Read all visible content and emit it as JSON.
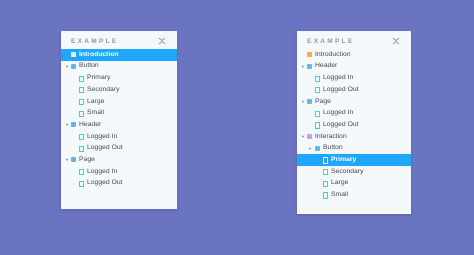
{
  "left_panel": {
    "title": "EXAMPLE",
    "rows": [
      {
        "label": "Introduction",
        "level": 0,
        "icon": "doc-icon",
        "arrow": "",
        "active": true
      },
      {
        "label": "Button",
        "level": 0,
        "icon": "component-icon",
        "arrow": "down",
        "active": false
      },
      {
        "label": "Primary",
        "level": 1,
        "icon": "story-icon",
        "arrow": "",
        "active": false
      },
      {
        "label": "Secondary",
        "level": 1,
        "icon": "story-icon",
        "arrow": "",
        "active": false
      },
      {
        "label": "Large",
        "level": 1,
        "icon": "story-icon",
        "arrow": "",
        "active": false
      },
      {
        "label": "Small",
        "level": 1,
        "icon": "story-icon",
        "arrow": "",
        "active": false
      },
      {
        "label": "Header",
        "level": 0,
        "icon": "component-icon",
        "arrow": "down",
        "active": false
      },
      {
        "label": "Logged In",
        "level": 1,
        "icon": "story-icon",
        "arrow": "",
        "active": false
      },
      {
        "label": "Logged Out",
        "level": 1,
        "icon": "story-icon",
        "arrow": "",
        "active": false
      },
      {
        "label": "Page",
        "level": 0,
        "icon": "component-icon",
        "arrow": "down",
        "active": false
      },
      {
        "label": "Logged In",
        "level": 1,
        "icon": "story-icon",
        "arrow": "",
        "active": false
      },
      {
        "label": "Logged Out",
        "level": 1,
        "icon": "story-icon",
        "arrow": "",
        "active": false
      }
    ]
  },
  "right_panel": {
    "title": "EXAMPLE",
    "rows": [
      {
        "label": "Introduction",
        "level": 0,
        "icon": "doc-icon",
        "arrow": "",
        "active": false
      },
      {
        "label": "Header",
        "level": 0,
        "icon": "component-icon",
        "arrow": "down",
        "active": false
      },
      {
        "label": "Logged In",
        "level": 1,
        "icon": "story-icon",
        "arrow": "",
        "active": false
      },
      {
        "label": "Logged Out",
        "level": 1,
        "icon": "story-icon",
        "arrow": "",
        "active": false
      },
      {
        "label": "Page",
        "level": 0,
        "icon": "component-icon",
        "arrow": "down",
        "active": false
      },
      {
        "label": "Logged In",
        "level": 1,
        "icon": "story-icon",
        "arrow": "",
        "active": false
      },
      {
        "label": "Logged Out",
        "level": 1,
        "icon": "story-icon",
        "arrow": "",
        "active": false
      },
      {
        "label": "Interaction",
        "level": 0,
        "icon": "folder-icon",
        "arrow": "down",
        "active": false
      },
      {
        "label": "Button",
        "level": 1,
        "icon": "component-icon",
        "arrow": "down",
        "active": false
      },
      {
        "label": "Primary",
        "level": 2,
        "icon": "story-icon",
        "arrow": "",
        "active": true
      },
      {
        "label": "Secondary",
        "level": 2,
        "icon": "story-icon",
        "arrow": "",
        "active": false
      },
      {
        "label": "Large",
        "level": 2,
        "icon": "story-icon",
        "arrow": "",
        "active": false
      },
      {
        "label": "Small",
        "level": 2,
        "icon": "story-icon",
        "arrow": "",
        "active": false
      }
    ]
  },
  "colors": {
    "background": "#6b74c0",
    "panel": "#f6f9fc",
    "active_row": "#1ea7fd",
    "component_icon": "#69b4e6",
    "story_icon": "#37d5d3",
    "doc_icon": "#f5b342"
  }
}
